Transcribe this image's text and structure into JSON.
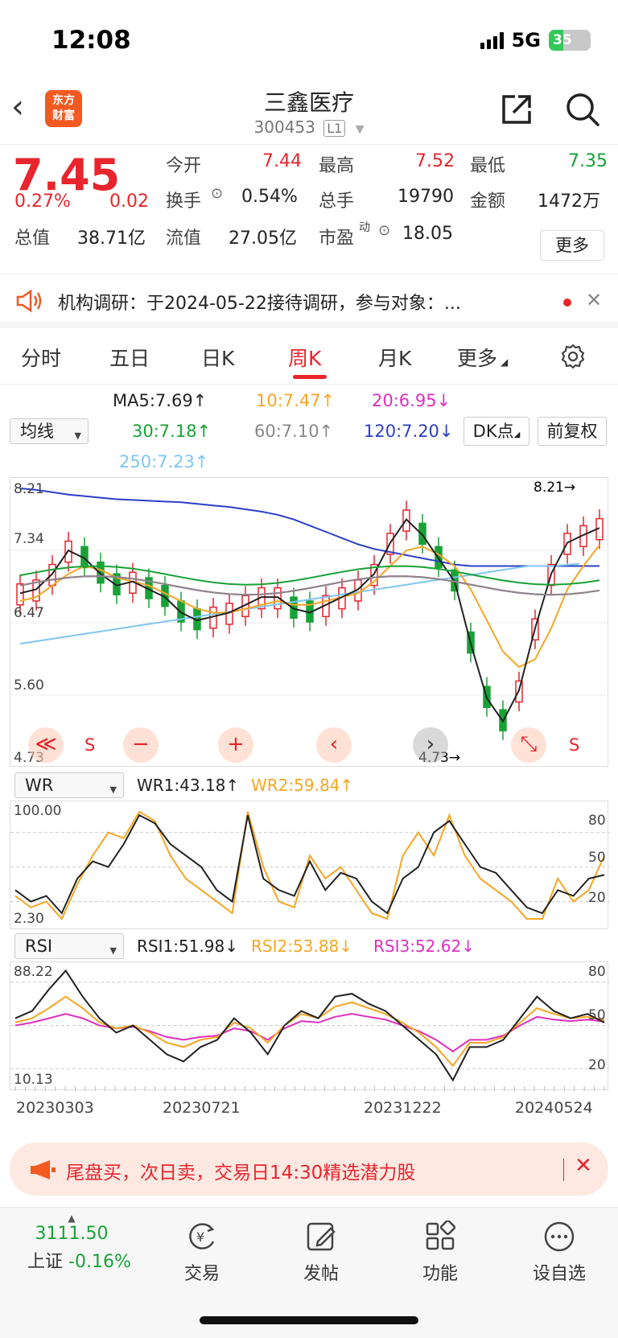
{
  "status": {
    "time": "12:08",
    "network": "5G",
    "battery": "35"
  },
  "nav": {
    "logo_line1": "东方",
    "logo_line2": "财富",
    "stock_name": "三鑫医疗",
    "stock_code": "300453",
    "level": "L1"
  },
  "quote": {
    "price": "7.45",
    "change_pct": "0.27%",
    "change": "0.02",
    "open_label": "今开",
    "open": "7.44",
    "high_label": "最高",
    "high": "7.52",
    "low_label": "最低",
    "low": "7.35",
    "turnover_label": "换手",
    "turnover": "0.54%",
    "volume_label": "总手",
    "volume": "19790",
    "amount_label": "金额",
    "amount": "1472万",
    "mktcap_label": "总值",
    "mktcap": "38.71亿",
    "float_label": "流值",
    "float": "27.05亿",
    "pe_label": "市盈",
    "pe_sup": "动",
    "pe": "18.05",
    "more": "更多"
  },
  "notice": {
    "text": "机构调研：于2024-05-22接待调研，参与对象：..."
  },
  "tabs": [
    "分时",
    "五日",
    "日K",
    "周K",
    "月K",
    "更多"
  ],
  "active_tab": 3,
  "ma_legend": {
    "selector": "均线",
    "ma5": "MA5:7.69↑",
    "ma10": "10:7.47↑",
    "ma20": "20:6.95↓",
    "ma30": "30:7.18↑",
    "ma60": "60:7.10↑",
    "ma120": "120:7.20↓",
    "ma250": "250:7.23↑",
    "dk": "DK点",
    "fq": "前复权"
  },
  "colors": {
    "up": "#e8242c",
    "down": "#18a236",
    "ma5": "#222222",
    "ma10": "#f5a623",
    "ma20": "#e02fbf",
    "ma30": "#18a236",
    "ma60": "#888888",
    "ma120": "#2b3fc6",
    "ma250": "#7fc6f0"
  },
  "kchart": {
    "y_labels": [
      "8.21",
      "7.34",
      "6.47",
      "5.60",
      "4.73"
    ],
    "max_marker": "8.21→",
    "min_marker": "4.73→",
    "s_label": "S",
    "ctrl": [
      "≪",
      "−",
      "+",
      "‹",
      "›",
      "⤡"
    ]
  },
  "chart_data": [
    {
      "type": "candlestick",
      "title": "",
      "ylim": [
        4.73,
        8.21
      ],
      "x_ticks": [
        "20230303",
        "20230721",
        "20231222",
        "20240524"
      ],
      "last_close": 7.45,
      "series_ma": [
        {
          "name": "MA5",
          "last": 7.69
        },
        {
          "name": "MA10",
          "last": 7.47
        },
        {
          "name": "MA20",
          "last": 6.95
        },
        {
          "name": "MA30",
          "last": 7.18
        },
        {
          "name": "MA60",
          "last": 7.1
        },
        {
          "name": "MA120",
          "last": 7.2
        },
        {
          "name": "MA250",
          "last": 7.23
        }
      ],
      "ma5_path": [
        6.85,
        6.9,
        7.1,
        7.4,
        7.3,
        7.1,
        6.95,
        7.0,
        6.9,
        6.8,
        6.6,
        6.5,
        6.55,
        6.6,
        6.7,
        6.8,
        6.8,
        6.65,
        6.6,
        6.7,
        6.8,
        6.9,
        7.1,
        7.5,
        7.8,
        7.6,
        7.3,
        7.0,
        6.2,
        5.5,
        5.2,
        5.6,
        6.4,
        7.1,
        7.5,
        7.6,
        7.69
      ],
      "ma10_path": [
        6.75,
        6.8,
        6.95,
        7.1,
        7.2,
        7.15,
        7.05,
        7.0,
        6.95,
        6.85,
        6.75,
        6.65,
        6.6,
        6.6,
        6.65,
        6.7,
        6.75,
        6.7,
        6.7,
        6.75,
        6.8,
        6.85,
        7.0,
        7.2,
        7.4,
        7.45,
        7.35,
        7.2,
        6.9,
        6.5,
        6.1,
        5.9,
        6.0,
        6.4,
        6.9,
        7.2,
        7.47
      ],
      "ma120_path": [
        8.2,
        8.18,
        8.15,
        8.12,
        8.1,
        8.08,
        8.06,
        8.05,
        8.04,
        8.03,
        8.02,
        8.0,
        7.98,
        7.96,
        7.93,
        7.9,
        7.86,
        7.8,
        7.72,
        7.64,
        7.56,
        7.48,
        7.42,
        7.38,
        7.34,
        7.3,
        7.26,
        7.22,
        7.2,
        7.2,
        7.2,
        7.2,
        7.2,
        7.2,
        7.2,
        7.2,
        7.2
      ],
      "ma250_path": [
        6.2,
        6.25,
        6.3,
        6.35,
        6.4,
        6.45,
        6.5,
        6.55,
        6.6,
        6.65,
        6.7,
        6.75,
        6.8,
        6.85,
        6.9,
        6.95,
        7.0,
        7.05,
        7.1,
        7.15,
        7.2,
        7.2,
        7.23
      ]
    },
    {
      "type": "line",
      "title": "WR",
      "ylim": [
        2.3,
        100.0
      ],
      "y_labels_left": [
        "100.00",
        "2.30"
      ],
      "y_labels_right": [
        "80",
        "50",
        "20"
      ],
      "series": [
        {
          "name": "WR1",
          "last": 43.18,
          "values": [
            30,
            20,
            25,
            10,
            40,
            55,
            50,
            70,
            95,
            88,
            70,
            60,
            50,
            30,
            20,
            95,
            40,
            30,
            25,
            55,
            30,
            45,
            40,
            20,
            10,
            40,
            50,
            80,
            90,
            70,
            50,
            45,
            30,
            15,
            10,
            30,
            25,
            40,
            43.18
          ]
        },
        {
          "name": "WR2",
          "last": 59.84,
          "values": [
            25,
            15,
            20,
            5,
            35,
            60,
            80,
            75,
            98,
            90,
            60,
            40,
            30,
            20,
            10,
            98,
            50,
            20,
            15,
            60,
            40,
            50,
            30,
            10,
            5,
            60,
            80,
            60,
            95,
            60,
            40,
            30,
            20,
            5,
            5,
            40,
            20,
            30,
            59.84
          ]
        }
      ]
    },
    {
      "type": "line",
      "title": "RSI",
      "ylim": [
        10.13,
        88.22
      ],
      "y_labels_left": [
        "88.22",
        "10.13"
      ],
      "y_labels_right": [
        "80",
        "50",
        "20"
      ],
      "series": [
        {
          "name": "RSI1",
          "last": 51.98,
          "values": [
            55,
            60,
            75,
            88,
            70,
            55,
            45,
            50,
            40,
            30,
            25,
            35,
            40,
            55,
            45,
            30,
            50,
            60,
            55,
            70,
            72,
            65,
            60,
            50,
            40,
            30,
            12,
            35,
            35,
            40,
            55,
            70,
            60,
            55,
            58,
            51.98
          ]
        },
        {
          "name": "RSI2",
          "last": 53.88,
          "values": [
            52,
            55,
            62,
            70,
            62,
            52,
            48,
            50,
            45,
            38,
            35,
            40,
            42,
            52,
            48,
            38,
            50,
            58,
            55,
            63,
            66,
            62,
            58,
            52,
            45,
            35,
            22,
            38,
            38,
            42,
            52,
            62,
            58,
            55,
            56,
            53.88
          ]
        },
        {
          "name": "RSI3",
          "last": 52.62,
          "values": [
            50,
            52,
            55,
            58,
            55,
            50,
            48,
            49,
            46,
            42,
            40,
            42,
            43,
            48,
            46,
            40,
            48,
            53,
            52,
            56,
            58,
            56,
            54,
            50,
            46,
            40,
            32,
            40,
            40,
            43,
            50,
            56,
            54,
            53,
            54,
            52.62
          ]
        }
      ]
    }
  ],
  "wr": {
    "selector": "WR",
    "wr1": "WR1:43.18↑",
    "wr2": "WR2:59.84↑",
    "y_top": "100.00",
    "y_bottom": "2.30",
    "r80": "80",
    "r50": "50",
    "r20": "20"
  },
  "rsi": {
    "selector": "RSI",
    "rsi1": "RSI1:51.98↓",
    "rsi2": "RSI2:53.88↓",
    "rsi3": "RSI3:52.62↓",
    "y_top": "88.22",
    "y_bottom": "10.13",
    "r80": "80",
    "r50": "50",
    "r20": "20"
  },
  "dates": [
    "20230303",
    "20230721",
    "20231222",
    "20240524"
  ],
  "promo": {
    "text": "尾盘买，次日卖，交易日14:30精选潜力股"
  },
  "bottom": {
    "index_value": "3111.50",
    "index_name": "上证",
    "index_change": "-0.16%",
    "trade": "交易",
    "post": "发帖",
    "func": "功能",
    "watch": "设自选"
  }
}
